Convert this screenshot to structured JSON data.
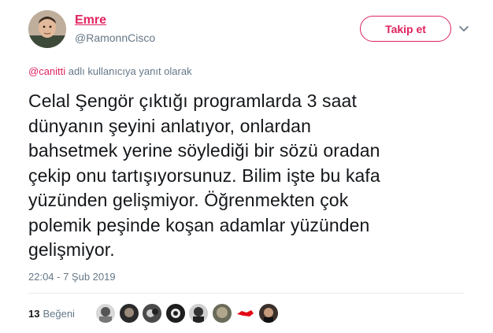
{
  "user": {
    "display_name": "Emre",
    "handle": "@RamonnCisco"
  },
  "follow_button": {
    "label": "Takip et"
  },
  "reply_context": {
    "mention": "@canitti",
    "text": " adlı kullanıcıya yanıt olarak"
  },
  "tweet": {
    "text": "Celal Şengör çıktığı programlarda 3 saat\ndünyanın şeyini anlatıyor, onlardan\nbahsetmek yerine söylediği bir sözü oradan\nçekip onu tartışıyorsunuz. Bilim işte bu kafa\nyüzünden gelişmiyor. Öğrenmekten çok\npolemik peşinde koşan adamlar yüzünden\ngelişmiyor.",
    "timestamp": "22:04 - 7 Şub 2019"
  },
  "likes": {
    "count": "13",
    "label": "Beğeni"
  },
  "colors": {
    "accent": "#e0245e",
    "secondary_text": "#657786",
    "primary_text": "#14171a",
    "divider": "#e6ecf0"
  },
  "icons": {
    "more": "chevron-down-icon"
  }
}
